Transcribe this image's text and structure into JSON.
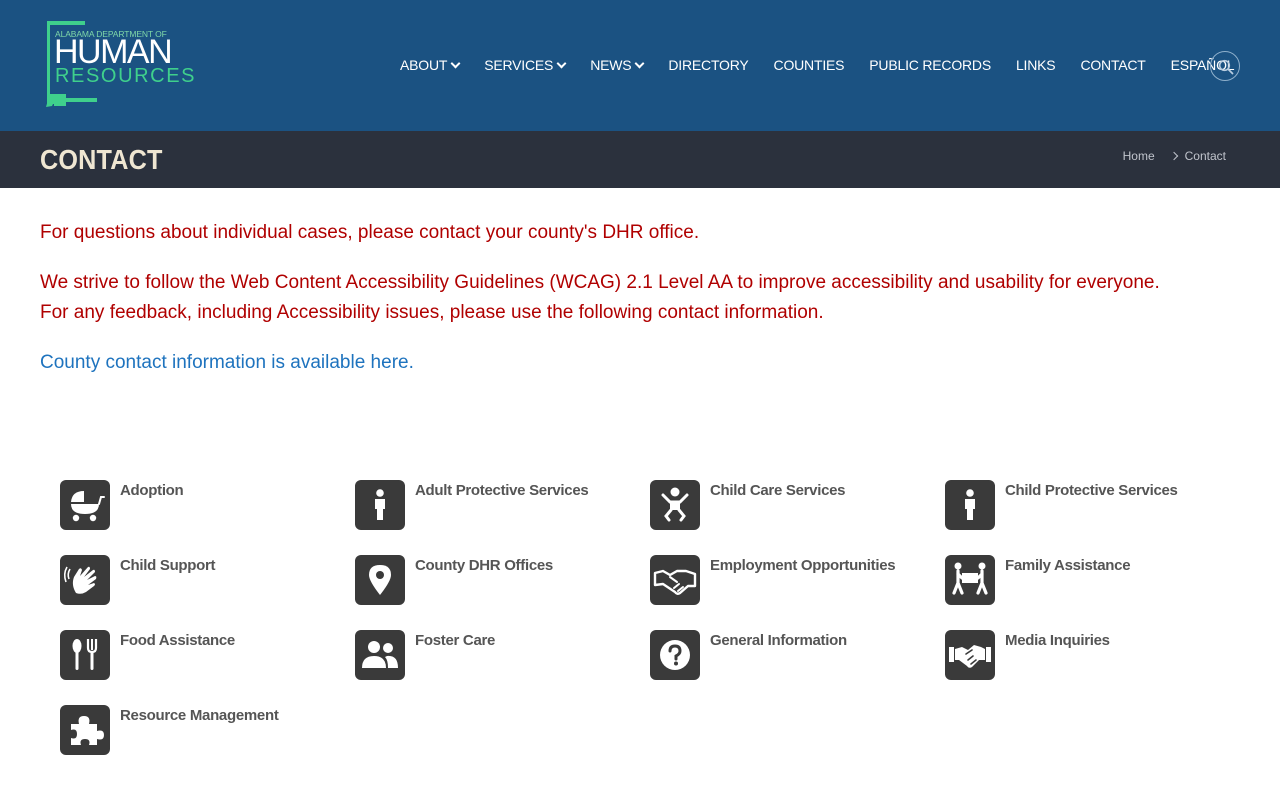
{
  "header": {
    "logo": {
      "line1": "ALABAMA DEPARTMENT OF",
      "line2": "HUMAN",
      "line3": "RESOURCES"
    },
    "nav": [
      {
        "label": "ABOUT",
        "dropdown": true
      },
      {
        "label": "SERVICES",
        "dropdown": true
      },
      {
        "label": "NEWS",
        "dropdown": true
      },
      {
        "label": "DIRECTORY",
        "dropdown": false
      },
      {
        "label": "COUNTIES",
        "dropdown": false
      },
      {
        "label": "PUBLIC RECORDS",
        "dropdown": false
      },
      {
        "label": "LINKS",
        "dropdown": false
      },
      {
        "label": "CONTACT",
        "dropdown": false
      },
      {
        "label": "ESPAÑOL",
        "dropdown": false
      }
    ],
    "search_icon": "search-icon"
  },
  "title_bar": {
    "title": "CONTACT",
    "breadcrumb": {
      "home": "Home",
      "current": "Contact"
    }
  },
  "content": {
    "notice1": "For questions about individual cases, please contact your county's DHR office.",
    "notice2_line1": "We strive to follow the Web Content Accessibility Guidelines (WCAG) 2.1 Level AA to improve accessibility and usability for everyone.",
    "notice2_line2": "For any feedback, including Accessibility issues, please use the following contact information.",
    "county_link": "County contact information is available here."
  },
  "services": [
    {
      "label": "Adoption",
      "icon": "baby-carriage-icon"
    },
    {
      "label": "Adult Protective Services",
      "icon": "person-icon"
    },
    {
      "label": "Child Care Services",
      "icon": "child-icon"
    },
    {
      "label": "Child Protective Services",
      "icon": "child-person-icon"
    },
    {
      "label": "Child Support",
      "icon": "hands-icon"
    },
    {
      "label": "County DHR Offices",
      "icon": "map-marker-icon"
    },
    {
      "label": "Employment Opportunities",
      "icon": "handshake-icon"
    },
    {
      "label": "Family Assistance",
      "icon": "people-carry-icon"
    },
    {
      "label": "Food Assistance",
      "icon": "utensils-icon"
    },
    {
      "label": "Foster Care",
      "icon": "user-friends-icon"
    },
    {
      "label": "General Information",
      "icon": "question-circle-icon"
    },
    {
      "label": "Media Inquiries",
      "icon": "handshake-alt-icon"
    },
    {
      "label": "Resource Management",
      "icon": "puzzle-piece-icon"
    }
  ],
  "colors": {
    "header_bg": "#1b5282",
    "title_bar_bg": "#2b313d",
    "notice_text": "#b00000",
    "link": "#1e73be",
    "icon_tile": "#3a3a3a",
    "logo_green": "#3fd08c"
  }
}
